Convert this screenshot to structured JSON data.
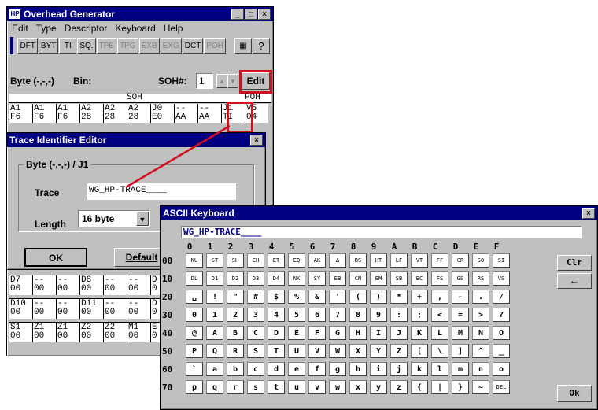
{
  "main_window": {
    "title": "Overhead Generator",
    "menu": [
      "Edit",
      "Type",
      "Descriptor",
      "Keyboard",
      "Help"
    ],
    "toolbar": [
      "DFT",
      "BYT",
      "TI",
      "SQ.",
      "TPB",
      "TPG",
      "EXB",
      "EXG",
      "DCT",
      "POH"
    ],
    "byte_label": "Byte (-,-,-)",
    "bin_label": "Bin:",
    "soh_num_label": "SOH#:",
    "soh_num_value": "1",
    "edit_button": "Edit",
    "soh_header": "SOH",
    "poh_header": "POH",
    "top_cells": [
      [
        "A1",
        "F6"
      ],
      [
        "A1",
        "F6"
      ],
      [
        "A1",
        "F6"
      ],
      [
        "A2",
        "28"
      ],
      [
        "A2",
        "28"
      ],
      [
        "A2",
        "28"
      ],
      [
        "J0",
        "E0"
      ],
      [
        "--",
        "AA"
      ],
      [
        "--",
        "AA"
      ],
      [
        "J1",
        "TI"
      ],
      [
        "V5",
        "04"
      ]
    ],
    "bottom_rows": [
      [
        [
          "D7",
          "00"
        ],
        [
          "--",
          "00"
        ],
        [
          "--",
          "00"
        ],
        [
          "D8",
          "00"
        ],
        [
          "--",
          "00"
        ],
        [
          "--",
          "00"
        ],
        [
          "D",
          "0"
        ]
      ],
      [
        [
          "D10",
          "00"
        ],
        [
          "--",
          "00"
        ],
        [
          "--",
          "00"
        ],
        [
          "D11",
          "00"
        ],
        [
          "--",
          "00"
        ],
        [
          "--",
          "00"
        ],
        [
          "D",
          "0"
        ]
      ],
      [
        [
          "S1",
          "00"
        ],
        [
          "Z1",
          "00"
        ],
        [
          "Z1",
          "00"
        ],
        [
          "Z2",
          "00"
        ],
        [
          "Z2",
          "00"
        ],
        [
          "M1",
          "00"
        ],
        [
          "E",
          "0"
        ]
      ]
    ]
  },
  "trace_editor": {
    "title": "Trace Identifier Editor",
    "group_label": "Byte (-,-,-) / J1",
    "trace_label": "Trace",
    "trace_value": "WG_HP-TRACE____",
    "length_label": "Length",
    "length_value": "16 byte",
    "ok_button": "OK",
    "default_button": "Default"
  },
  "ascii_keyboard": {
    "title": "ASCII Keyboard",
    "input_value": "WG_HP-TRACE____",
    "col_headers": [
      "0",
      "1",
      "2",
      "3",
      "4",
      "5",
      "6",
      "7",
      "8",
      "9",
      "A",
      "B",
      "C",
      "D",
      "E",
      "F"
    ],
    "row_labels": [
      "00",
      "10",
      "20",
      "30",
      "40",
      "50",
      "60",
      "70"
    ],
    "rows": [
      [
        "NU",
        "ST",
        "SH",
        "EH",
        "ET",
        "EQ",
        "AK",
        "Δ",
        "BS",
        "HT",
        "LF",
        "VT",
        "FF",
        "CR",
        "SO",
        "SI"
      ],
      [
        "DL",
        "D1",
        "D2",
        "D3",
        "D4",
        "NK",
        "SY",
        "EB",
        "CN",
        "EM",
        "SB",
        "EC",
        "FS",
        "GS",
        "RS",
        "VS"
      ],
      [
        "␣",
        "!",
        "\"",
        "#",
        "$",
        "%",
        "&",
        "'",
        "(",
        ")",
        "*",
        "+",
        ",",
        "-",
        ".",
        "/"
      ],
      [
        "0",
        "1",
        "2",
        "3",
        "4",
        "5",
        "6",
        "7",
        "8",
        "9",
        ":",
        ";",
        "<",
        "=",
        ">",
        "?"
      ],
      [
        "@",
        "A",
        "B",
        "C",
        "D",
        "E",
        "F",
        "G",
        "H",
        "I",
        "J",
        "K",
        "L",
        "M",
        "N",
        "O"
      ],
      [
        "P",
        "Q",
        "R",
        "S",
        "T",
        "U",
        "V",
        "W",
        "X",
        "Y",
        "Z",
        "[",
        "\\",
        "]",
        "^",
        "_"
      ],
      [
        "`",
        "a",
        "b",
        "c",
        "d",
        "e",
        "f",
        "g",
        "h",
        "i",
        "j",
        "k",
        "l",
        "m",
        "n",
        "o"
      ],
      [
        "p",
        "q",
        "r",
        "s",
        "t",
        "u",
        "v",
        "w",
        "x",
        "y",
        "z",
        "{",
        "|",
        "}",
        "~",
        "DEL"
      ]
    ],
    "clr_button": "Clr",
    "backspace_button": "←",
    "ok_button": "Ok"
  }
}
